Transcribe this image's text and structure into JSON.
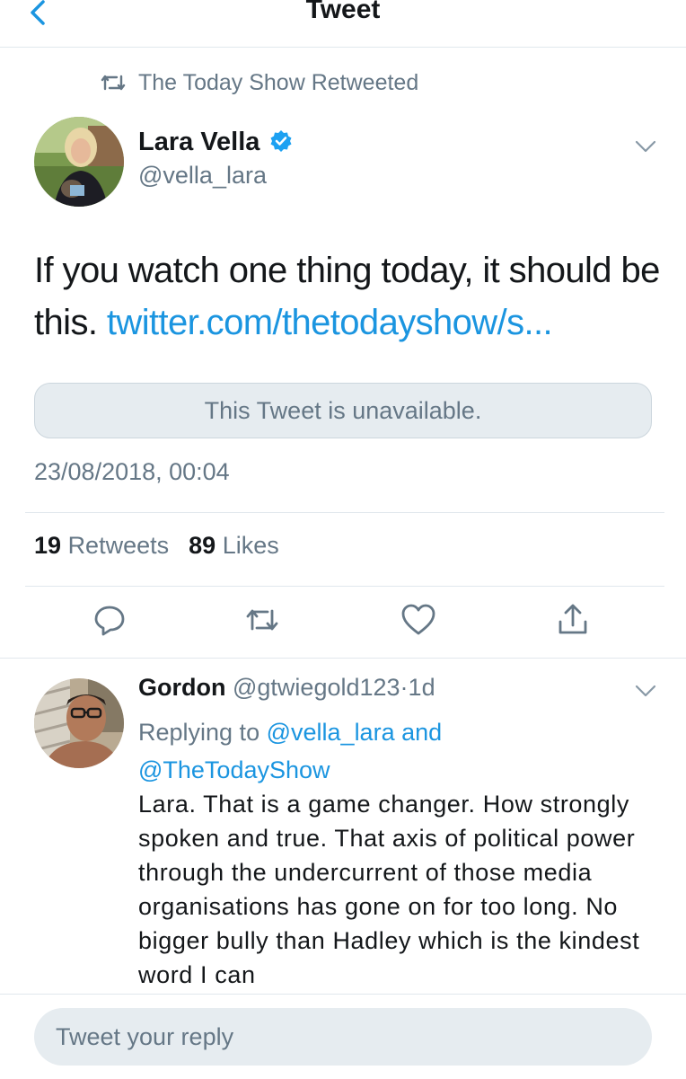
{
  "header": {
    "title": "Tweet"
  },
  "retweet_context": {
    "label": "The Today Show Retweeted"
  },
  "tweet": {
    "author_name": "Lara Vella",
    "author_handle": "@vella_lara",
    "verified": true,
    "text": "If you watch one thing today, it should be this.",
    "link_text": "twitter.com/thetodayshow/s...",
    "quoted_unavailable": "This Tweet is unavailable.",
    "timestamp": "23/08/2018, 00:04",
    "retweet_count": "19",
    "retweet_label": "Retweets",
    "like_count": "89",
    "like_label": "Likes"
  },
  "reply": {
    "author_name": "Gordon",
    "author_handle": "@gtwiegold123",
    "separator": "·",
    "age": "1d",
    "replying_prefix": "Replying to",
    "replying_user1": "@vella_lara",
    "replying_and": "and",
    "replying_user2": "@TheTodayShow",
    "text": "Lara. That is a game changer. How strongly spoken and true. That axis of political power through the undercurrent of those media organisations has gone on for too long. No bigger bully than Hadley which is the kindest word I can"
  },
  "composer": {
    "placeholder": "Tweet your reply"
  },
  "colors": {
    "accent": "#1b95e0",
    "secondary_text": "#657786",
    "divider": "#e1e8ed"
  },
  "icons": [
    "back-chevron-icon",
    "retweet-icon",
    "verified-badge-icon",
    "chevron-down-icon",
    "reply-icon",
    "retweet-icon",
    "like-heart-icon",
    "share-icon"
  ]
}
